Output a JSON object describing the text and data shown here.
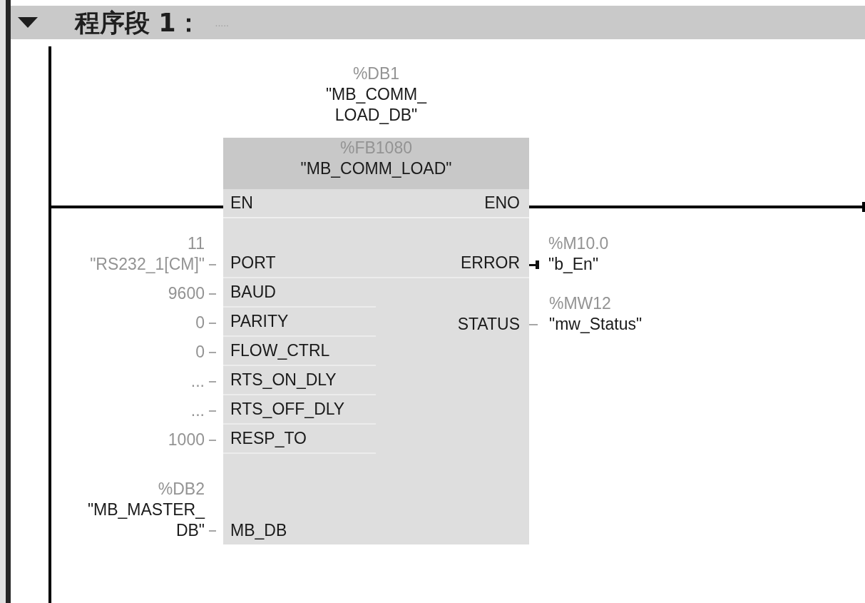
{
  "network": {
    "title": "程序段 1：",
    "comment": ".....",
    "expanded": true
  },
  "block": {
    "instance": {
      "address": "%DB1",
      "name": "\"MB_COMM_\nLOAD_DB\""
    },
    "type": {
      "address": "%FB1080",
      "name": "\"MB_COMM_LOAD\""
    },
    "en": "EN",
    "eno": "ENO",
    "inputs": [
      {
        "pin": "PORT",
        "address": "11",
        "operand": "\"RS232_1[CM]\"",
        "kind": "constant"
      },
      {
        "pin": "BAUD",
        "operand": "9600",
        "kind": "constant"
      },
      {
        "pin": "PARITY",
        "operand": "0",
        "kind": "constant"
      },
      {
        "pin": "FLOW_CTRL",
        "operand": "0",
        "kind": "constant"
      },
      {
        "pin": "RTS_ON_DLY",
        "operand": "...",
        "kind": "constant"
      },
      {
        "pin": "RTS_OFF_DLY",
        "operand": "...",
        "kind": "constant"
      },
      {
        "pin": "RESP_TO",
        "operand": "1000",
        "kind": "constant"
      },
      {
        "pin": "MB_DB",
        "address": "%DB2",
        "operand": "\"MB_MASTER_\nDB\"",
        "kind": "symbol"
      }
    ],
    "outputs": [
      {
        "pin": "ERROR",
        "address": "%M10.0",
        "operand": "\"b_En\"",
        "kind": "bool"
      },
      {
        "pin": "STATUS",
        "address": "%MW12",
        "operand": "\"mw_Status\"",
        "kind": "word"
      }
    ]
  }
}
